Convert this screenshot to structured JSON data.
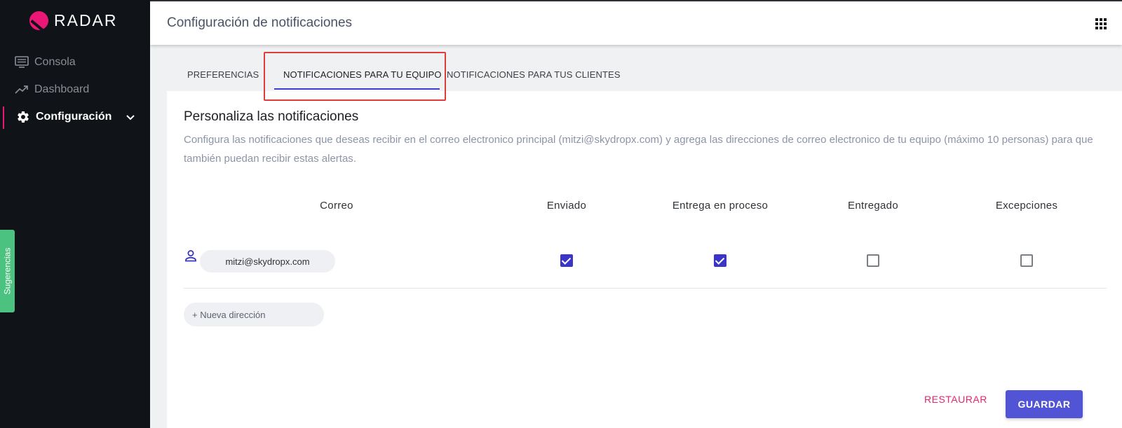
{
  "brand": {
    "name": "RADAR",
    "accent": "#ec1677"
  },
  "sidebar": {
    "items": [
      {
        "label": "Consola",
        "icon": "monitor-icon",
        "active": false
      },
      {
        "label": "Dashboard",
        "icon": "trending-up-icon",
        "active": false
      },
      {
        "label": "Configuración",
        "icon": "gear-icon",
        "active": true,
        "expandable": true
      }
    ],
    "feedback_label": "Sugerencias"
  },
  "header": {
    "title": "Configuración de notificaciones",
    "apps_icon": "apps-grid-icon"
  },
  "tabs": [
    {
      "label": "PREFERENCIAS",
      "selected": false
    },
    {
      "label": "NOTIFICACIONES PARA TU EQUIPO",
      "selected": true
    },
    {
      "label": "NOTIFICACIONES PARA TUS CLIENTES",
      "selected": false
    }
  ],
  "card": {
    "title": "Personaliza las notificaciones",
    "description": "Configura las notificaciones que deseas recibir en el correo electronico principal (mitzi@skydropx.com) y agrega las direcciones de correo electronico de tu equipo (máximo 10 personas) para que también puedan recibir estas alertas."
  },
  "table": {
    "columns": [
      "Correo",
      "Enviado",
      "Entrega en proceso",
      "Entregado",
      "Excepciones"
    ],
    "rows": [
      {
        "email": "mitzi@skydropx.com",
        "enviado": true,
        "entrega_en_proceso": true,
        "entregado": false,
        "excepciones": false
      }
    ]
  },
  "new_address": {
    "placeholder": "+ Nueva dirección",
    "value": ""
  },
  "actions": {
    "restore_label": "RESTAURAR",
    "save_label": "GUARDAR"
  },
  "colors": {
    "primary": "#5254d6",
    "checkbox_checked": "#3a35c7",
    "restore": "#e2266f",
    "feedback": "#4bc27f",
    "sidebar_bg": "#101317"
  }
}
